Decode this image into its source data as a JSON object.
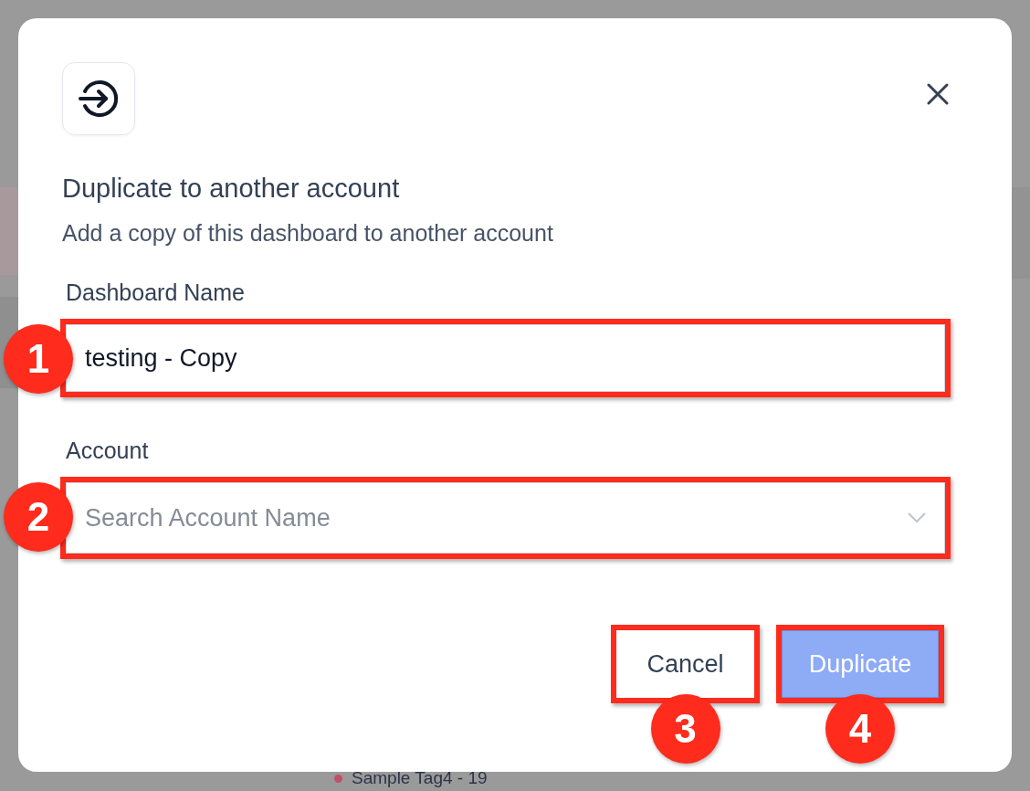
{
  "background": {
    "legend_item": {
      "label": "Sample Tag4 - 19",
      "color": "#c0506a"
    }
  },
  "dialog": {
    "title": "Duplicate to another account",
    "subtitle": "Add a copy of this dashboard to another account",
    "fields": [
      {
        "kind": "text",
        "label": "Dashboard Name",
        "value": "testing - Copy",
        "callout": "1"
      },
      {
        "kind": "select",
        "label": "Account",
        "placeholder": "Search Account Name",
        "callout": "2"
      }
    ],
    "buttons": [
      {
        "kind": "secondary",
        "label": "Cancel",
        "callout": "3"
      },
      {
        "kind": "primary",
        "label": "Duplicate",
        "callout": "4"
      }
    ]
  }
}
